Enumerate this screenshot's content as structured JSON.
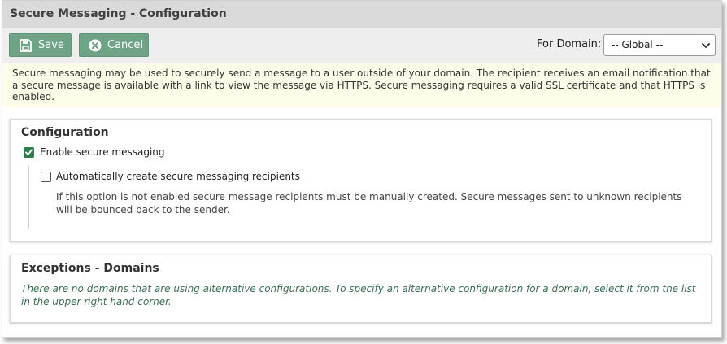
{
  "window": {
    "title": "Secure Messaging - Configuration"
  },
  "toolbar": {
    "save_label": "Save",
    "cancel_label": "Cancel",
    "domain_label": "For Domain:",
    "domain_selected": "-- Global --"
  },
  "info": {
    "text": "Secure messaging may be used to securely send a message to a user outside of your domain. The recipient receives an email notification that a secure message is available with a link to view the message via HTTPS. Secure messaging requires a valid SSL certificate and that HTTPS is enabled."
  },
  "configuration": {
    "heading": "Configuration",
    "enable_label": "Enable secure messaging",
    "enable_checked": true,
    "auto_create_label": "Automatically create secure messaging recipients",
    "auto_create_checked": false,
    "auto_create_help": "If this option is not enabled secure message recipients must be manually created. Secure messages sent to unknown recipients will be bounced back to the sender."
  },
  "exceptions": {
    "heading": "Exceptions - Domains",
    "empty_text": "There are no domains that are using alternative configurations. To specify an alternative configuration for a domain, select it from the list in the upper right hand corner."
  },
  "colors": {
    "button_bg": "#6fa386",
    "checkbox_checked": "#2e7d4f",
    "info_bg": "#fefde9",
    "italic_note": "#3a6f51"
  },
  "icons": {
    "save": "floppy-disk-icon",
    "cancel": "cancel-circle-icon",
    "select": "chevron-down-icon",
    "check": "checkmark-icon"
  }
}
